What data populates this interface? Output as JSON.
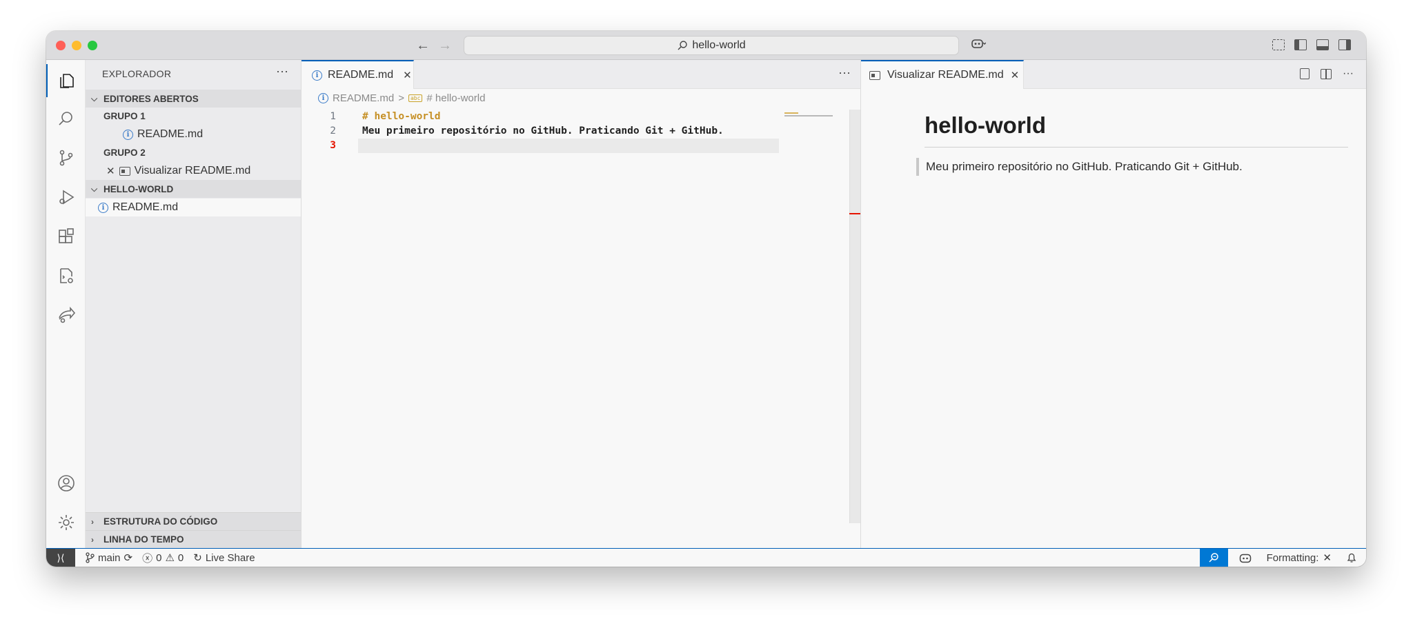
{
  "titlebar": {
    "search_text": "hello-world",
    "back_icon": "arrow-left-icon",
    "forward_icon": "arrow-right-icon"
  },
  "activity_bar": {
    "items": [
      "explorer-icon",
      "search-icon",
      "source-control-icon",
      "run-debug-icon",
      "extensions-icon",
      "remote-explorer-icon",
      "live-share-icon"
    ],
    "bottom": [
      "account-icon",
      "manage-gear-icon"
    ]
  },
  "sidebar": {
    "title": "EXPLORADOR",
    "more": "···",
    "open_editors": {
      "label": "EDITORES ABERTOS",
      "group1": {
        "label": "GRUPO 1",
        "file": "README.md"
      },
      "group2": {
        "label": "GRUPO 2",
        "file": "Visualizar README.md"
      }
    },
    "folder": {
      "label": "HELLO-WORLD",
      "files": [
        "README.md"
      ]
    },
    "outline": "ESTRUTURA DO CÓDIGO",
    "timeline": "LINHA DO TEMPO"
  },
  "editor": {
    "tab_label": "README.md",
    "more": "···",
    "breadcrumb": {
      "file": "README.md",
      "separator": ">",
      "symbol": "# hello-world"
    },
    "lines": [
      {
        "number": "1",
        "text": "# hello-world",
        "kind": "heading"
      },
      {
        "number": "2",
        "text": "Meu primeiro repositório no GitHub. Praticando Git + GitHub.",
        "kind": "text"
      },
      {
        "number": "3",
        "text": "",
        "kind": "current"
      }
    ]
  },
  "preview": {
    "tab_label": "Visualizar README.md",
    "more": "···",
    "heading": "hello-world",
    "quote": "Meu primeiro repositório no GitHub. Praticando Git + GitHub."
  },
  "statusbar": {
    "branch": "main",
    "errors": "0",
    "warnings": "0",
    "live_share": "Live Share",
    "formatting": "Formatting:"
  },
  "colors": {
    "accent": "#005fb8",
    "heading_code": "#c69026",
    "current_line_number": "#e51400",
    "zoom_button": "#0078d4"
  }
}
